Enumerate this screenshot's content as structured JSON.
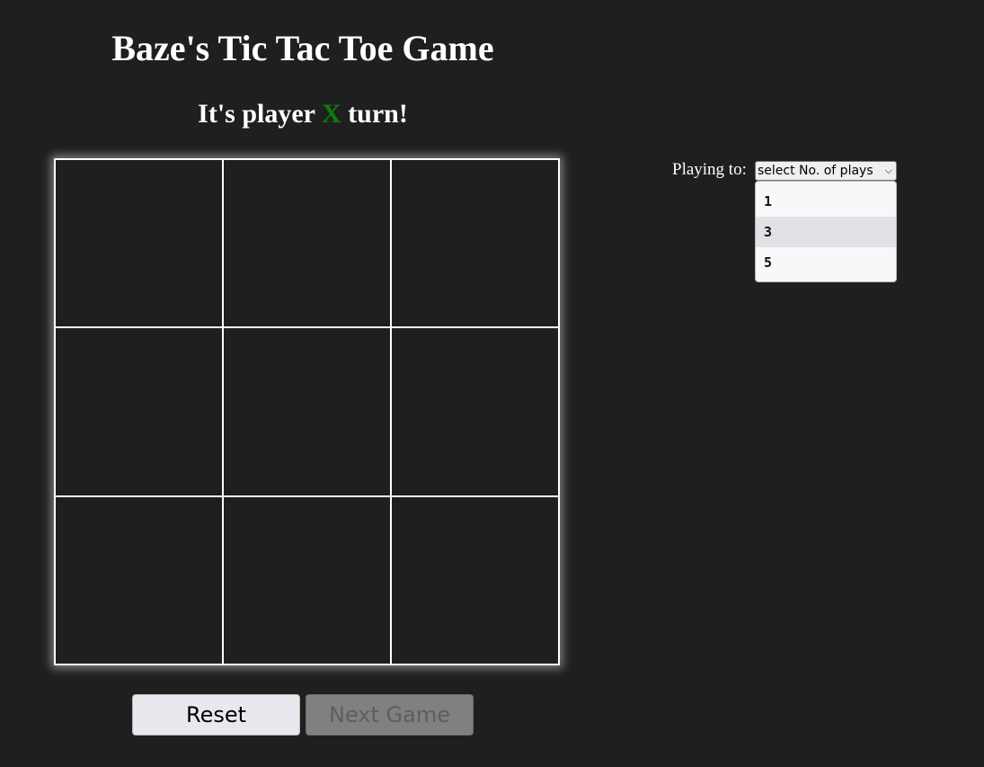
{
  "header": {
    "title": "Baze's Tic Tac Toe Game",
    "turn_prefix": "It's player ",
    "turn_player": "X",
    "turn_suffix": " turn!",
    "player_color": "#0a7f0a"
  },
  "board": {
    "cells": [
      "",
      "",
      "",
      "",
      "",
      "",
      "",
      "",
      ""
    ]
  },
  "controls": {
    "reset_label": "Reset",
    "next_game_label": "Next Game",
    "next_game_disabled": true
  },
  "settings": {
    "playing_to_label": "Playing to:",
    "select_value": "select No. of plays",
    "chevron_icon": "chevron-down-icon",
    "options": [
      "1",
      "3",
      "5"
    ],
    "highlighted_option": "3"
  }
}
